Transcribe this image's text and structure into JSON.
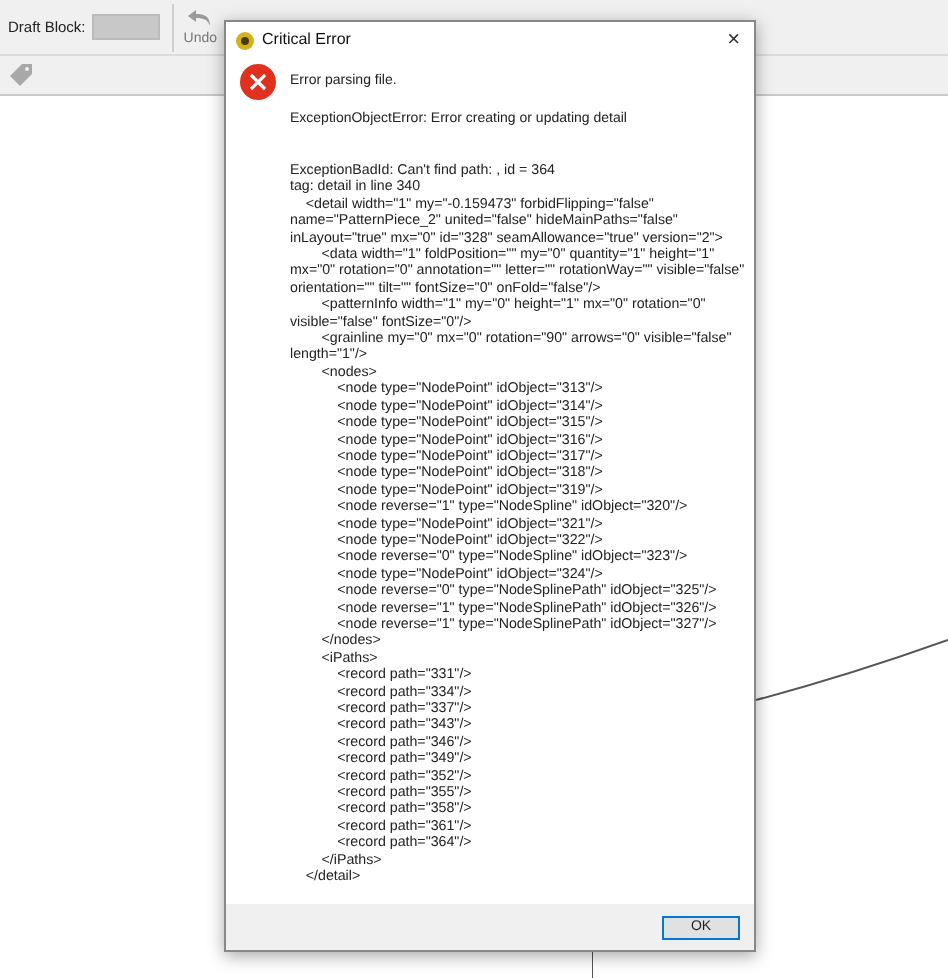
{
  "toolbar": {
    "draft_block_label": "Draft Block:",
    "undo_label": "Undo"
  },
  "dialog": {
    "title": "Critical Error",
    "close": "×",
    "message": "Error parsing file.",
    "exception": "ExceptionObjectError: Error creating or updating detail",
    "detail_lines": [
      "ExceptionBadId: Can't find path: , id = 364",
      "tag: detail in line 340",
      "    <detail width=\"1\" my=\"-0.159473\" forbidFlipping=\"false\" name=\"PatternPiece_2\" united=\"false\" hideMainPaths=\"false\" inLayout=\"true\" mx=\"0\" id=\"328\" seamAllowance=\"true\" version=\"2\">",
      "        <data width=\"1\" foldPosition=\"\" my=\"0\" quantity=\"1\" height=\"1\" mx=\"0\" rotation=\"0\" annotation=\"\" letter=\"\" rotationWay=\"\" visible=\"false\" orientation=\"\" tilt=\"\" fontSize=\"0\" onFold=\"false\"/>",
      "        <patternInfo width=\"1\" my=\"0\" height=\"1\" mx=\"0\" rotation=\"0\" visible=\"false\" fontSize=\"0\"/>",
      "        <grainline my=\"0\" mx=\"0\" rotation=\"90\" arrows=\"0\" visible=\"false\" length=\"1\"/>",
      "        <nodes>",
      "            <node type=\"NodePoint\" idObject=\"313\"/>",
      "            <node type=\"NodePoint\" idObject=\"314\"/>",
      "            <node type=\"NodePoint\" idObject=\"315\"/>",
      "            <node type=\"NodePoint\" idObject=\"316\"/>",
      "            <node type=\"NodePoint\" idObject=\"317\"/>",
      "            <node type=\"NodePoint\" idObject=\"318\"/>",
      "            <node type=\"NodePoint\" idObject=\"319\"/>",
      "            <node reverse=\"1\" type=\"NodeSpline\" idObject=\"320\"/>",
      "            <node type=\"NodePoint\" idObject=\"321\"/>",
      "            <node type=\"NodePoint\" idObject=\"322\"/>",
      "            <node reverse=\"0\" type=\"NodeSpline\" idObject=\"323\"/>",
      "            <node type=\"NodePoint\" idObject=\"324\"/>",
      "            <node reverse=\"0\" type=\"NodeSplinePath\" idObject=\"325\"/>",
      "            <node reverse=\"1\" type=\"NodeSplinePath\" idObject=\"326\"/>",
      "            <node reverse=\"1\" type=\"NodeSplinePath\" idObject=\"327\"/>",
      "        </nodes>",
      "        <iPaths>",
      "            <record path=\"331\"/>",
      "            <record path=\"334\"/>",
      "            <record path=\"337\"/>",
      "            <record path=\"343\"/>",
      "            <record path=\"346\"/>",
      "            <record path=\"349\"/>",
      "            <record path=\"352\"/>",
      "            <record path=\"355\"/>",
      "            <record path=\"358\"/>",
      "            <record path=\"361\"/>",
      "            <record path=\"364\"/>",
      "        </iPaths>",
      "    </detail>"
    ],
    "ok_button": "OK"
  }
}
